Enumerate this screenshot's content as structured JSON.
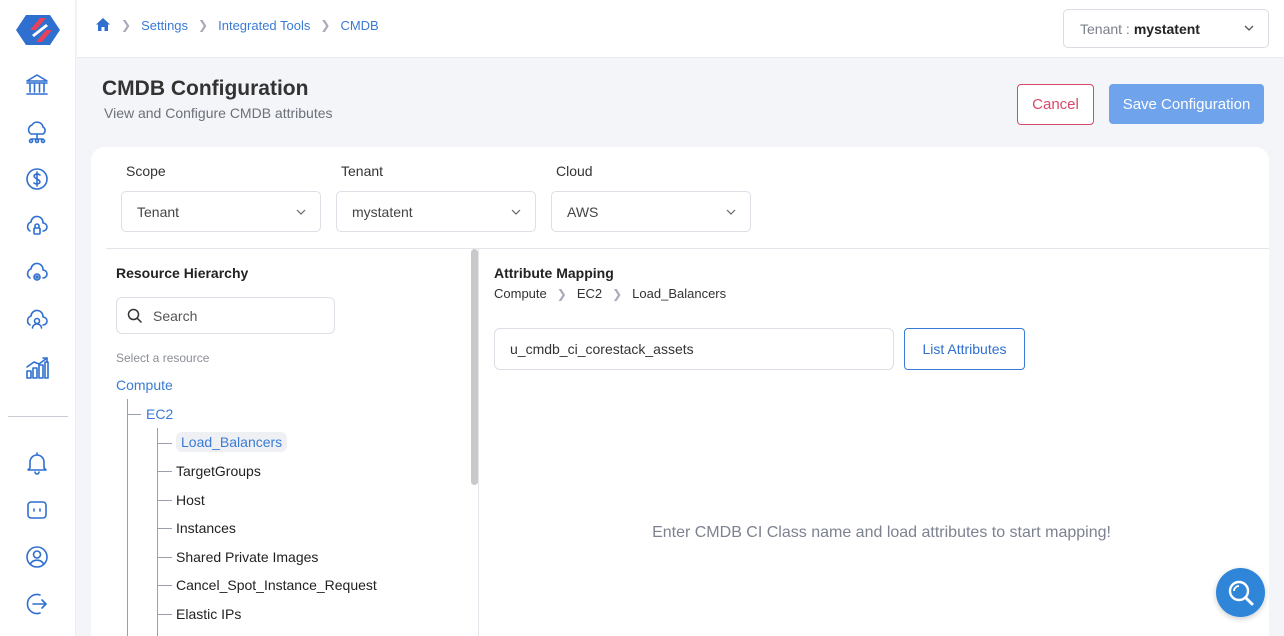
{
  "breadcrumb": {
    "items": [
      "Settings",
      "Integrated Tools",
      "CMDB"
    ]
  },
  "tenant_selector": {
    "label": "Tenant :",
    "value": "mystatent"
  },
  "header": {
    "title": "CMDB Configuration",
    "subtitle": "View and Configure CMDB attributes",
    "cancel_label": "Cancel",
    "save_label": "Save Configuration"
  },
  "filters": {
    "scope": {
      "label": "Scope",
      "value": "Tenant"
    },
    "tenant": {
      "label": "Tenant",
      "value": "mystatent"
    },
    "cloud": {
      "label": "Cloud",
      "value": "AWS"
    }
  },
  "resource_hierarchy": {
    "title": "Resource Hierarchy",
    "search_placeholder": "Search",
    "hint": "Select a resource",
    "root": "Compute",
    "group": "EC2",
    "selected": "Load_Balancers",
    "items": [
      "TargetGroups",
      "Host",
      "Instances",
      "Shared Private Images",
      "Cancel_Spot_Instance_Request",
      "Elastic IPs"
    ]
  },
  "attribute_mapping": {
    "title": "Attribute Mapping",
    "path": [
      "Compute",
      "EC2",
      "Load_Balancers"
    ],
    "ci_class_value": "u_cmdb_ci_corestack_assets",
    "list_label": "List Attributes",
    "empty_message": "Enter CMDB CI Class name and load attributes to start mapping!"
  },
  "colors": {
    "accent": "#2f6fd0",
    "link": "#3a7bd5",
    "cancel": "#d9476a",
    "save": "#6fa3eb"
  },
  "icons": {
    "sidebar": [
      "bank-icon",
      "cloud-network-icon",
      "dollar-icon",
      "cloud-lock-icon",
      "cloud-gear-icon",
      "cloud-user-icon",
      "analytics-icon",
      "bell-icon",
      "chat-bot-icon",
      "user-icon",
      "logout-icon"
    ],
    "fab": "search-help-icon"
  }
}
